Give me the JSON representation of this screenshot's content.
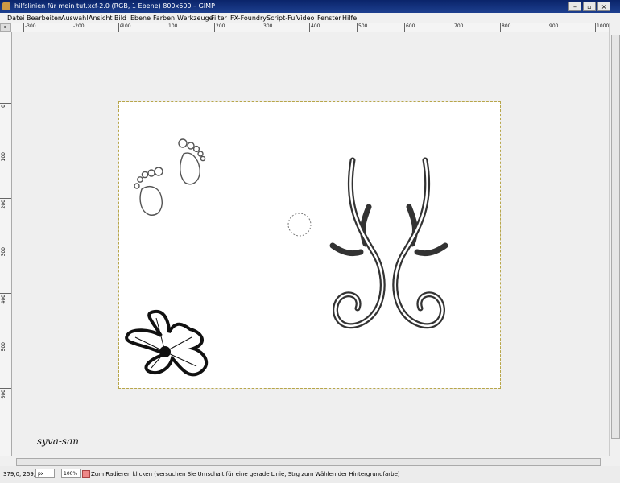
{
  "window": {
    "title": "hilfslinien für mein tut.xcf-2.0 (RGB, 1 Ebene) 800x600 – GIMP",
    "controls": [
      "–",
      "▫",
      "×"
    ]
  },
  "menu": [
    "Datei",
    "Bearbeiten",
    "Auswahl",
    "Ansicht",
    "Bild",
    "Ebene",
    "Farben",
    "Werkzeuge",
    "Filter",
    "FX-Foundry",
    "Script-Fu",
    "Video",
    "Fenster",
    "Hilfe"
  ],
  "ruler": {
    "h_labels": [
      "-300",
      "-200",
      "-100",
      "0",
      "100",
      "200",
      "300",
      "400",
      "500",
      "600",
      "700",
      "800",
      "900",
      "1000"
    ],
    "v_labels": [
      "0",
      "100",
      "200",
      "300",
      "400",
      "500",
      "600"
    ]
  },
  "canvas": {
    "signature": "syva-san"
  },
  "status": {
    "coords": "379,0, 259,0",
    "unit": "px",
    "zoom": "100%",
    "message": "Zum Radieren klicken (versuchen Sie Umschalt für eine gerade Linie, Strg zum Wählen der Hintergrundfarbe)"
  },
  "colors": {
    "titlebar": "#0a246a",
    "canvas_bg": "#efefef",
    "image_bg": "#ffffff",
    "guide": "#b8a64a"
  }
}
